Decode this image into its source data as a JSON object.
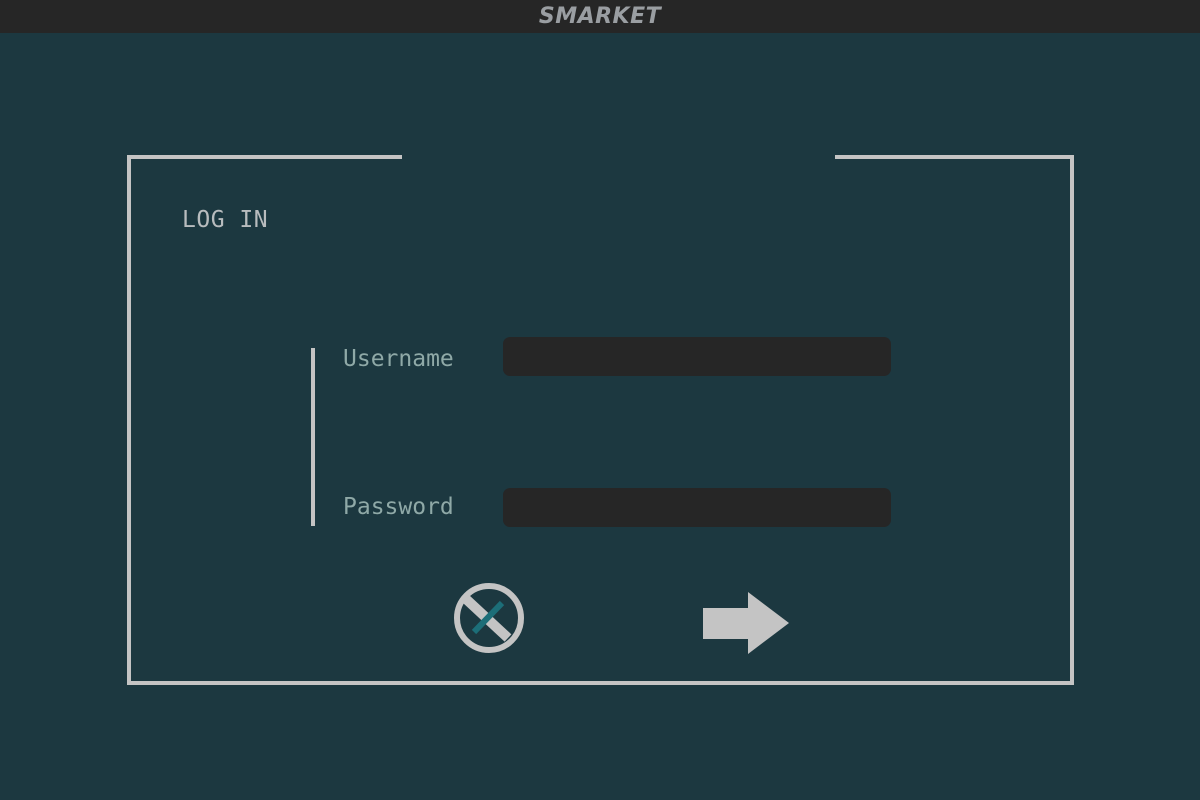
{
  "header": {
    "app_title": "SMARKET"
  },
  "login": {
    "heading": "LOG IN",
    "username_label": "Username",
    "username_value": "",
    "password_label": "Password",
    "password_value": ""
  },
  "actions": {
    "cancel_icon": "prohibited-icon",
    "submit_icon": "arrow-right-icon"
  },
  "colors": {
    "background": "#1c3840",
    "topbar": "#262626",
    "frame": "#c4c4c4",
    "input_bg": "#262626",
    "label": "#8fa9a7"
  }
}
